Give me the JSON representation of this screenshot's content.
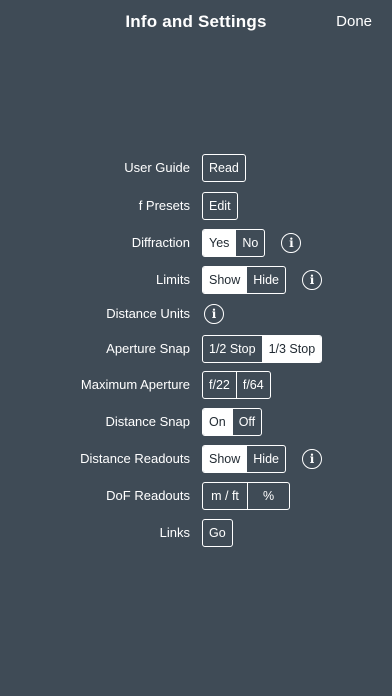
{
  "header": {
    "title": "Info and Settings",
    "done_label": "Done"
  },
  "settings": {
    "user_guide": {
      "label": "User Guide",
      "button": "Read"
    },
    "f_presets": {
      "label": "f Presets",
      "button": "Edit"
    },
    "diffraction": {
      "label": "Diffraction",
      "options": [
        "Yes",
        "No"
      ],
      "selected": "Yes",
      "info_icon": "info-icon"
    },
    "limits": {
      "label": "Limits",
      "options": [
        "Show",
        "Hide"
      ],
      "selected": "Show",
      "info_icon": "info-icon"
    },
    "distance_units": {
      "label": "Distance Units",
      "info_icon": "info-icon"
    },
    "aperture_snap": {
      "label": "Aperture Snap",
      "options": [
        "1/2 Stop",
        "1/3 Stop"
      ],
      "selected": "1/3 Stop"
    },
    "maximum_aperture": {
      "label": "Maximum Aperture",
      "options": [
        "f/22",
        "f/64"
      ],
      "selected": "none"
    },
    "distance_snap": {
      "label": "Distance Snap",
      "options": [
        "On",
        "Off"
      ],
      "selected": "On"
    },
    "distance_readouts": {
      "label": "Distance Readouts",
      "options": [
        "Show",
        "Hide"
      ],
      "selected": "Show",
      "info_icon": "info-icon"
    },
    "dof_readouts": {
      "label": "DoF Readouts",
      "options": [
        "m / ft",
        "%"
      ],
      "selected": "none"
    },
    "links": {
      "label": "Links",
      "button": "Go"
    }
  },
  "colors": {
    "background": "#3f4b56",
    "foreground": "#ffffff",
    "selected_text": "#222b33"
  }
}
